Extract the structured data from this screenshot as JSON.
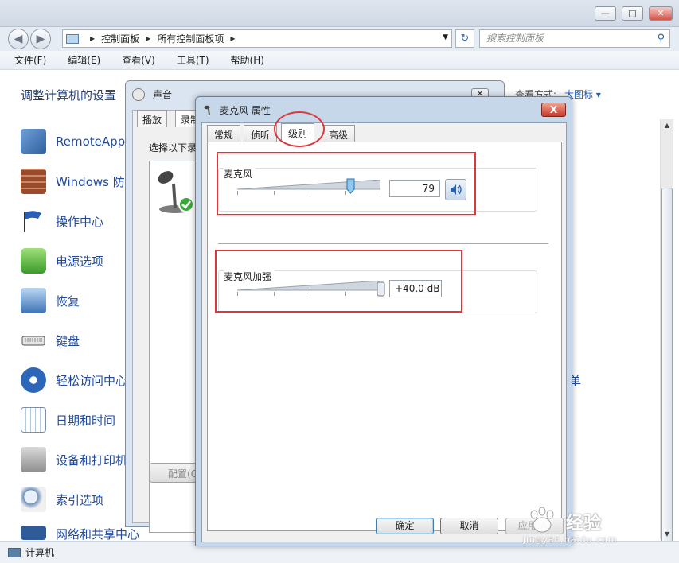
{
  "explorer": {
    "window_controls": {
      "minimize": "—",
      "maximize": "□",
      "close": "✕"
    },
    "breadcrumb": [
      "控制面板",
      "所有控制面板项"
    ],
    "search_placeholder": "搜索控制面板",
    "menu": [
      "文件(F)",
      "编辑(E)",
      "查看(V)",
      "工具(T)",
      "帮助(H)"
    ],
    "heading": "调整计算机的设置",
    "view_by_label": "查看方式:",
    "view_by_value": "大图标 ▾",
    "items": [
      {
        "label": "RemoteApp",
        "icon": "remoteapp-icon"
      },
      {
        "label": "Windows 防",
        "icon": "firewall-icon"
      },
      {
        "label": "操作中心",
        "icon": "action-center-flag-icon"
      },
      {
        "label": "电源选项",
        "icon": "power-options-icon"
      },
      {
        "label": "恢复",
        "icon": "recovery-icon"
      },
      {
        "label": "键盘",
        "icon": "keyboard-icon"
      },
      {
        "label": "轻松访问中心",
        "icon": "ease-of-access-icon"
      },
      {
        "label": "日期和时间",
        "icon": "calendar-clock-icon"
      },
      {
        "label": "设备和打印机",
        "icon": "printer-icon"
      },
      {
        "label": "索引选项",
        "icon": "indexing-icon"
      },
      {
        "label": "网络和共享中心",
        "icon": "network-icon"
      }
    ],
    "right_partial_label": "单",
    "status": "计算机"
  },
  "sound_dialog": {
    "title": "声音",
    "close": "✕",
    "tabs": [
      "播放",
      "录制"
    ],
    "description": "选择以下录",
    "configure_button": "配置(C"
  },
  "mic_properties": {
    "title": "麦克风 属性",
    "close": "X",
    "tabs": [
      "常规",
      "侦听",
      "级别",
      "高级"
    ],
    "active_tab": "级别",
    "microphone": {
      "label": "麦克风",
      "value_text": "79",
      "level": 79,
      "max": 100
    },
    "boost": {
      "label": "麦克风加强",
      "value_text": "+40.0 dB",
      "level": 40,
      "max": 40
    },
    "buttons": {
      "ok": "确定",
      "cancel": "取消",
      "apply": "应用(A)"
    }
  },
  "watermark": {
    "brand": "经验",
    "url": "jingyan.baidu.com"
  },
  "colors": {
    "annotation_red": "#d9383c",
    "link_blue": "#1f4aa0",
    "heading_blue": "#1d3c78"
  }
}
